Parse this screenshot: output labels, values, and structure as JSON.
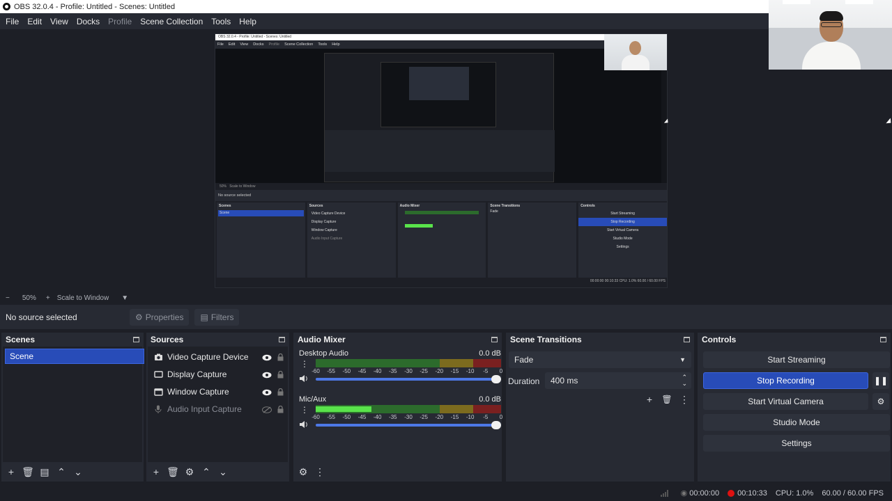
{
  "window": {
    "title": "OBS 32.0.4 - Profile: Untitled - Scenes: Untitled"
  },
  "menu": [
    "File",
    "Edit",
    "View",
    "Docks",
    "Profile",
    "Scene Collection",
    "Tools",
    "Help"
  ],
  "preview": {
    "zoom": "50%",
    "scale_mode": "Scale to Window",
    "nested_title": "OBS 32.0.4 - Profile: Untitled - Scenes: Untitled",
    "nested_menu": [
      "File",
      "Edit",
      "View",
      "Docks",
      "Profile",
      "Scene Collection",
      "Tools",
      "Help"
    ],
    "nested_status": "00:00:00  00:10:33  CPU: 1.0%  60.00 / 60.00 FPS"
  },
  "source_bar": {
    "no_source": "No source selected",
    "properties": "Properties",
    "filters": "Filters"
  },
  "scenes": {
    "title": "Scenes",
    "items": [
      "Scene"
    ]
  },
  "sources": {
    "title": "Sources",
    "items": [
      {
        "label": "Video Capture Device",
        "icon": "camera-icon"
      },
      {
        "label": "Display Capture",
        "icon": "monitor-icon"
      },
      {
        "label": "Window Capture",
        "icon": "window-icon"
      },
      {
        "label": "Audio Input Capture",
        "icon": "microphone-icon"
      }
    ]
  },
  "mixer": {
    "title": "Audio Mixer",
    "ticks": [
      "-60",
      "-55",
      "-50",
      "-45",
      "-40",
      "-35",
      "-30",
      "-25",
      "-20",
      "-15",
      "-10",
      "-5",
      "0"
    ],
    "channels": [
      {
        "name": "Desktop Audio",
        "db": "0.0 dB",
        "level": 0.0,
        "volume": 1.0
      },
      {
        "name": "Mic/Aux",
        "db": "0.0 dB",
        "level": 0.3,
        "volume": 1.0
      }
    ]
  },
  "transitions": {
    "title": "Scene Transitions",
    "selected": "Fade",
    "duration_label": "Duration",
    "duration_value": "400 ms"
  },
  "controls": {
    "title": "Controls",
    "start_streaming": "Start Streaming",
    "stop_recording": "Stop Recording",
    "start_virtual_camera": "Start Virtual Camera",
    "studio_mode": "Studio Mode",
    "settings": "Settings"
  },
  "status": {
    "stream_time": "00:00:00",
    "rec_time": "00:10:33",
    "cpu": "CPU: 1.0%",
    "fps": "60.00 / 60.00 FPS"
  },
  "colors": {
    "accent": "#284cb8",
    "record": "#dd1111",
    "meter_green": "#59e34b"
  }
}
